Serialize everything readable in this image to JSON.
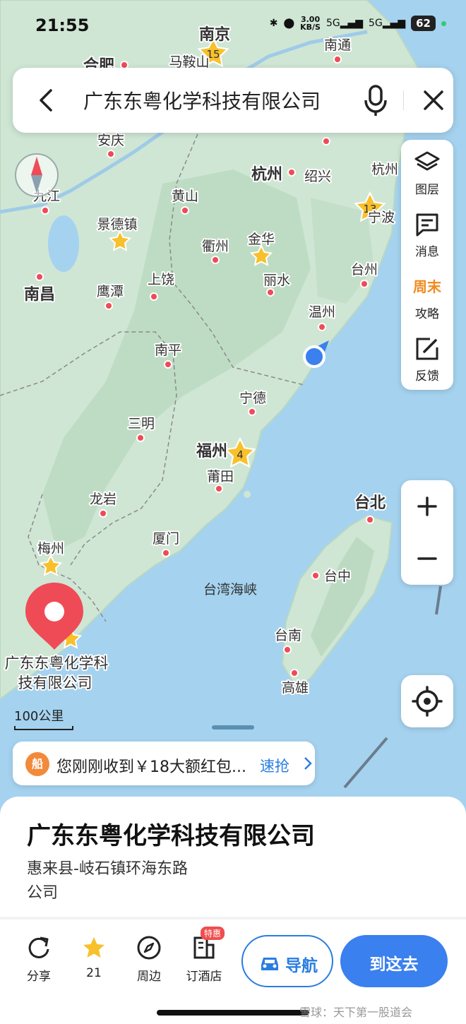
{
  "status_bar": {
    "time": "21:55",
    "net_speed_value": "3.00",
    "net_speed_unit": "KB/S",
    "signal_1": "5G",
    "signal_2": "5G",
    "battery": "62"
  },
  "search": {
    "query": "广东东粤化学科技有限公司"
  },
  "toolbar": {
    "layers": "图层",
    "messages": "消息",
    "weekend_badge": "周末",
    "guide": "攻略",
    "feedback": "反馈"
  },
  "map": {
    "labels": {
      "nanjing": "南京",
      "hefei": "合肥",
      "maanshan": "马鞍山",
      "nantong": "南通",
      "anqing": "安庆",
      "hangzhou": "杭州",
      "shaoxing": "绍兴",
      "hangzhou_bay": "杭州",
      "jiujiang": "九江",
      "huangshan": "黄山",
      "ningbo": "宁波",
      "jingdezhen": "景德镇",
      "quzhou": "衢州",
      "jinhua": "金华",
      "taizhou": "台州",
      "nanchang": "南昌",
      "yingtan": "鹰潭",
      "shangrao": "上饶",
      "lishui": "丽水",
      "wenzhou": "温州",
      "nanping": "南平",
      "ningde": "宁德",
      "sanming": "三明",
      "fuzhou": "福州",
      "putian": "莆田",
      "taipei": "台北",
      "longyan": "龙岩",
      "xiamen": "厦门",
      "meizhou": "梅州",
      "taiwan_strait": "台湾海峡",
      "taichung": "台中",
      "tainan": "台南",
      "kaohsiung": "高雄",
      "poi_line1": "广东东粤化学科",
      "poi_line2": "技有限公司"
    },
    "cluster_badges": {
      "nanjing": "15",
      "ningbo": "13",
      "fuzhou": "4"
    },
    "scale": "100公里"
  },
  "promo": {
    "badge": "船",
    "text": "您刚刚收到￥18大额红包...",
    "action": "速抢"
  },
  "place": {
    "name": "广东东粤化学科技有限公司",
    "address": "惠来县-岐石镇环海东路",
    "category": "公司"
  },
  "actions": {
    "share": "分享",
    "favorite": "21",
    "nearby": "周边",
    "hotel": "订酒店",
    "hotel_tag": "特惠",
    "navigate": "导航",
    "go_here": "到这去"
  },
  "watermark": "雪球：天下第一股道会",
  "colors": {
    "sea": "#a5d2ef",
    "land": "#cfe6d4",
    "accent_blue": "#3a80ee",
    "pin_red": "#ef4b57",
    "star_yellow": "#f8c02a"
  }
}
